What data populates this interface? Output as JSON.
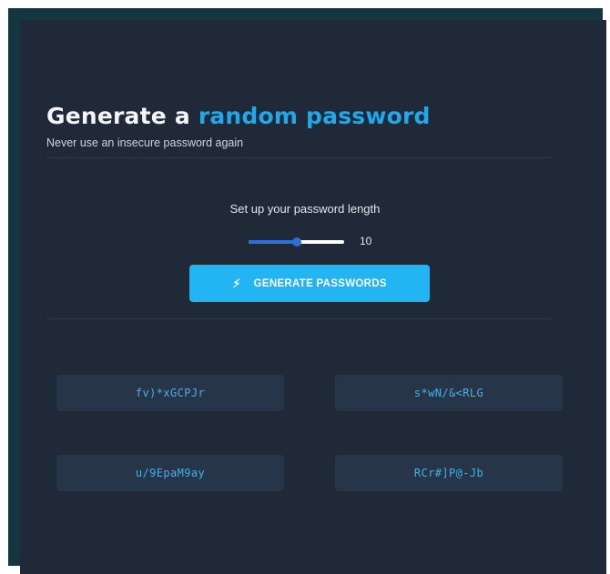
{
  "header": {
    "title_prefix": "Generate a ",
    "title_accent": "random password",
    "subtitle": "Never use an insecure password again"
  },
  "length": {
    "label": "Set up your password length",
    "value": 10,
    "slider_fraction": 0.5
  },
  "generate_button": {
    "icon": "lightning-bolt-icon",
    "label": "GENERATE PASSWORDS"
  },
  "passwords": [
    "fv)*xGCPJr",
    "s*wN/&<RLG",
    "u/9EpaM9ay",
    "RCr#]P@-Jb"
  ],
  "colors": {
    "background": "#1f2937",
    "frame": "#13363f",
    "accent": "#1fa9ec",
    "button": "#22b4f3",
    "slider": "#2d6fd8",
    "password_box": "#273549",
    "password_text": "#3eb3ea"
  }
}
